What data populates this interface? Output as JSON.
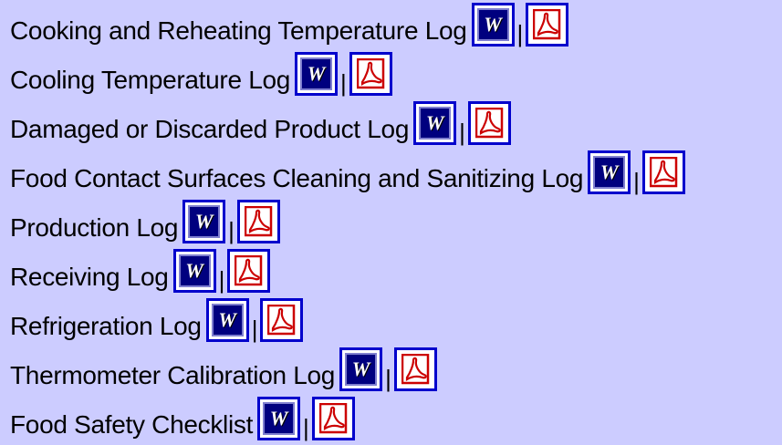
{
  "docs": [
    {
      "label": "Cooking and Reheating Temperature Log",
      "separator": "|"
    },
    {
      "label": "Cooling Temperature Log",
      "separator": "|"
    },
    {
      "label": "Damaged or Discarded Product Log",
      "separator": "|"
    },
    {
      "label": "Food Contact Surfaces Cleaning and Sanitizing Log",
      "separator": "|"
    },
    {
      "label": "Production Log",
      "separator": "|"
    },
    {
      "label": "Receiving Log",
      "separator": "|"
    },
    {
      "label": "Refrigeration Log",
      "separator": "|"
    },
    {
      "label": "Thermometer Calibration Log",
      "separator": "|"
    },
    {
      "label": "Food Safety Checklist",
      "separator": "|"
    }
  ],
  "icons": {
    "word": {
      "name": "word-doc-icon",
      "glyph": "W"
    },
    "pdf": {
      "name": "pdf-acrobat-icon"
    }
  },
  "colors": {
    "background": "#ccccff",
    "link_border": "#0000cc",
    "word_fill": "#00007f",
    "pdf_red": "#cc0000"
  }
}
